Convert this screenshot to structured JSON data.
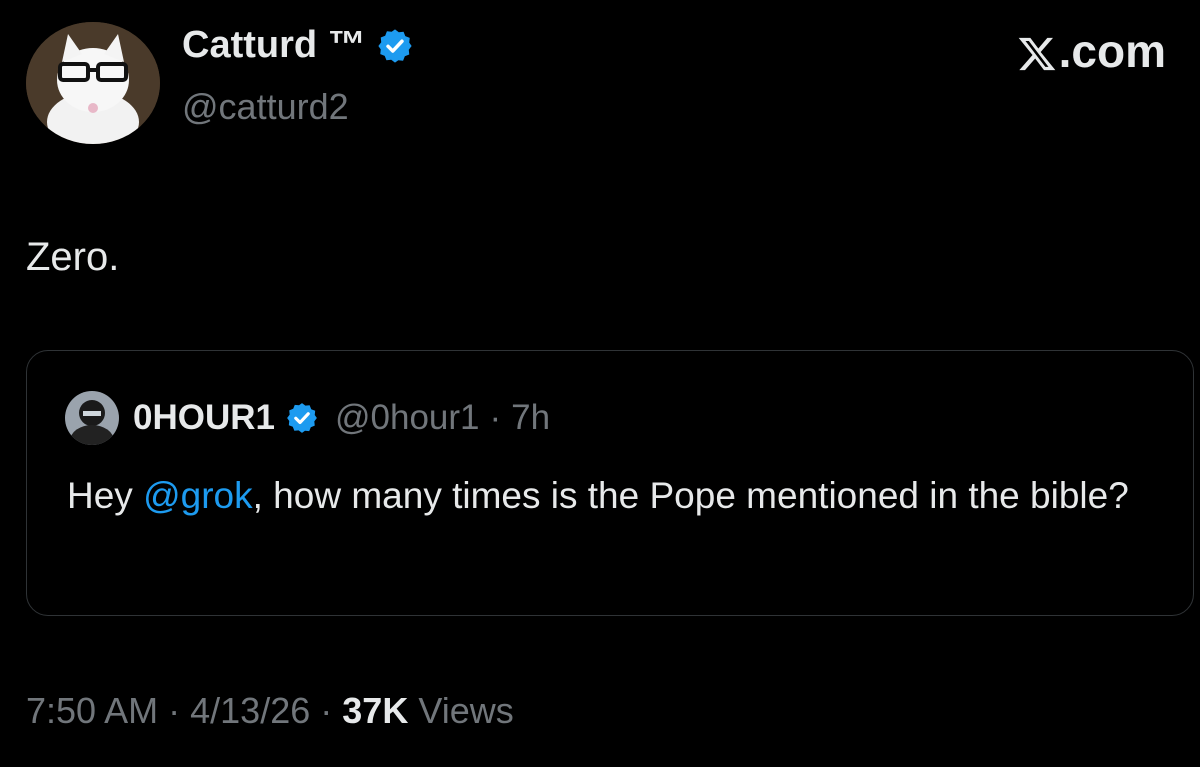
{
  "author": {
    "display_name": "Catturd ™",
    "handle": "@catturd2",
    "verified_icon": "verified-badge-icon",
    "avatar": "cat-with-glasses-avatar"
  },
  "brand": {
    "label": ".com",
    "icon": "x-logo-icon"
  },
  "tweet": {
    "text": "Zero."
  },
  "quoted": {
    "display_name": "0HOUR1",
    "handle": "@0hour1",
    "separator": "·",
    "time": "7h",
    "text_before": "Hey ",
    "mention": "@grok",
    "text_after": ", how many times is the Pope mentioned in the bible?"
  },
  "meta": {
    "time": "7:50 AM",
    "sep1": "·",
    "date": "4/13/26",
    "sep2": "·",
    "views_count": "37K",
    "views_label": "Views"
  },
  "colors": {
    "background": "#000000",
    "text": "#e7e9ea",
    "muted": "#71767b",
    "accent": "#1d9bf0",
    "border": "#2f3336"
  }
}
